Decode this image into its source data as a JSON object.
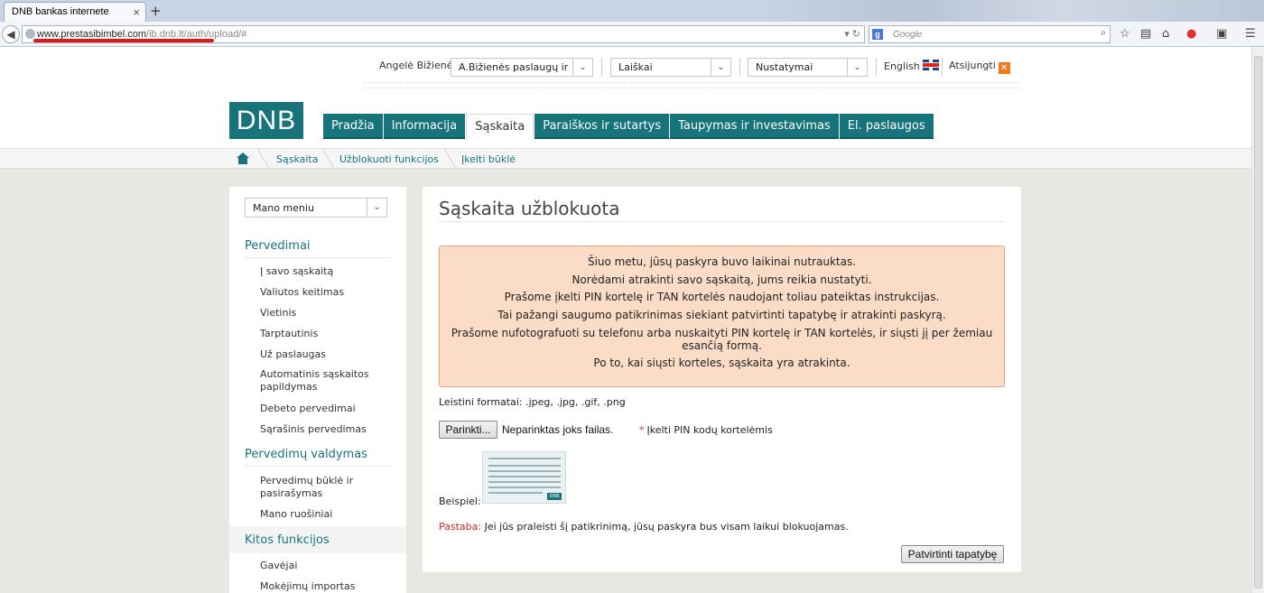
{
  "browser": {
    "tab_title": "DNB bankas internete",
    "url_host": "www.prestasibimbel.com",
    "url_path": "/ib.dnb.lt/auth/upload/#",
    "search_placeholder": "Google"
  },
  "topbar": {
    "user_name": "Angelė Bižienė",
    "account_select": "A.Bižienės paslaugų ir",
    "messages_select": "Laiškai",
    "settings_select": "Nustatymai",
    "language": "English",
    "logout": "Atsijungti"
  },
  "logo": {
    "text": "DNB"
  },
  "main_nav": [
    {
      "label": "Pradžia",
      "active": false
    },
    {
      "label": "Informacija",
      "active": false
    },
    {
      "label": "Sąskaita",
      "active": true
    },
    {
      "label": "Paraiškos ir sutartys",
      "active": false
    },
    {
      "label": "Taupymas ir investavimas",
      "active": false
    },
    {
      "label": "El. paslaugos",
      "active": false
    }
  ],
  "breadcrumb": [
    "Sąskaita",
    "Užblokuoti funkcijos",
    "Įkelti būklė"
  ],
  "sidebar": {
    "menu_select": "Mano meniu",
    "sections": [
      {
        "title": "Pervedimai",
        "links": [
          "Į savo sąskaitą",
          "Valiutos keitimas",
          "Vietinis",
          "Tarptautinis",
          "Už paslaugas",
          "Automatinis sąskaitos papildymas",
          "Debeto pervedimai",
          "Sąrašinis pervedimas"
        ]
      },
      {
        "title": "Pervedimų valdymas",
        "links": [
          "Pervedimų būklė ir pasirašymas",
          "Mano ruošiniai"
        ]
      },
      {
        "title": "Kitos funkcijos",
        "links": [
          "Gavėjai",
          "Mokėjimų importas"
        ]
      }
    ]
  },
  "content": {
    "title": "Sąskaita užblokuota",
    "alert_lines": [
      "Šiuo metu, jūsų paskyra buvo laikinai nutrauktas.",
      "Norėdami atrakinti savo sąskaitą, jums reikia nustatyti.",
      "Prašome įkelti PIN kortelę ir TAN kortelės naudojant toliau pateiktas instrukcijas.",
      "Tai pažangi saugumo patikrinimas siekiant patvirtinti tapatybę ir atrakinti paskyrą.",
      "Prašome nufotografuoti su telefonu arba nuskaityti PIN kortelę ir TAN kortelės, ir siųsti jį per žemiau esančią formą.",
      "Po to, kai siųsti korteles, sąskaita yra atrakinta."
    ],
    "formats": "Leistini formatai: .jpeg, .jpg, .gif, .png",
    "browse_button": "Parinkti...",
    "no_file": "Neparinktas joks failas.",
    "required_star": "*",
    "required_label": "Įkelti PIN kodų kortelėmis",
    "example_label": "Beispiel:",
    "card_logo": "DNB",
    "note_label": "Pastaba:",
    "note_text": "Jei jūs praleisti šį patikrinimą, jūsų paskyra bus visam laikui blokuojamas.",
    "confirm_button": "Patvirtinti tapatybę"
  },
  "colors": {
    "brand": "#17747b",
    "alert_bg": "#fbddc7",
    "alert_border": "#e7a57b",
    "required": "#dd2222"
  }
}
